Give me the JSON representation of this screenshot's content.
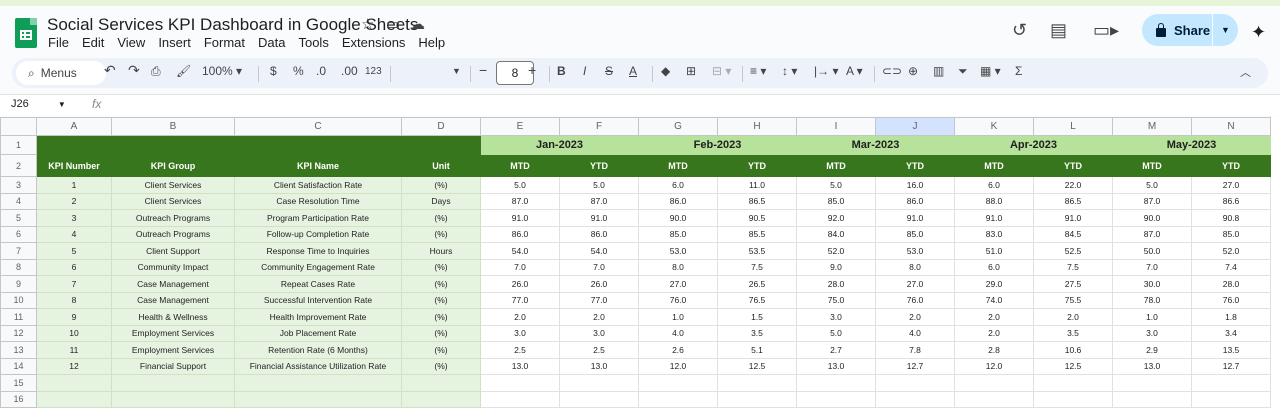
{
  "app": {
    "doc_title": "Social Services KPI Dashboard in Google Sheets",
    "menu": [
      "File",
      "Edit",
      "View",
      "Insert",
      "Format",
      "Data",
      "Tools",
      "Extensions",
      "Help"
    ],
    "share_label": "Share",
    "accent": "#c2e7ff",
    "header_dark": "#38761d",
    "header_light": "#b6e29b",
    "kpi_fill": "#e7f3e1"
  },
  "toolbar": {
    "menus_label": "Menus",
    "zoom": "100%",
    "currency": "$",
    "percent": "%",
    "dec_decrease": ".0",
    "dec_increase": ".00",
    "number_format": "123",
    "font_size": "8"
  },
  "formula_bar": {
    "cell_ref": "J26",
    "fx": "fx"
  },
  "columns": [
    "A",
    "B",
    "C",
    "D",
    "E",
    "F",
    "G",
    "H",
    "I",
    "J",
    "K",
    "L",
    "M",
    "N"
  ],
  "selected_column": "J",
  "row_numbers": [
    "1",
    "2",
    "3",
    "4",
    "5",
    "6",
    "7",
    "8",
    "9",
    "10",
    "11",
    "12",
    "13",
    "14",
    "15",
    "16"
  ],
  "months": [
    "Jan-2023",
    "Feb-2023",
    "Mar-2023",
    "Apr-2023",
    "May-2023"
  ],
  "headers": {
    "kpi_number": "KPI Number",
    "kpi_group": "KPI Group",
    "kpi_name": "KPI Name",
    "unit": "Unit",
    "mtd": "MTD",
    "ytd": "YTD"
  },
  "rows": [
    {
      "num": "1",
      "group": "Client Services",
      "name": "Client Satisfaction Rate",
      "unit": "(%)",
      "vals": [
        "5.0",
        "5.0",
        "6.0",
        "11.0",
        "5.0",
        "16.0",
        "6.0",
        "22.0",
        "5.0",
        "27.0"
      ]
    },
    {
      "num": "2",
      "group": "Client Services",
      "name": "Case Resolution Time",
      "unit": "Days",
      "vals": [
        "87.0",
        "87.0",
        "86.0",
        "86.5",
        "85.0",
        "86.0",
        "88.0",
        "86.5",
        "87.0",
        "86.6"
      ]
    },
    {
      "num": "3",
      "group": "Outreach Programs",
      "name": "Program Participation Rate",
      "unit": "(%)",
      "vals": [
        "91.0",
        "91.0",
        "90.0",
        "90.5",
        "92.0",
        "91.0",
        "91.0",
        "91.0",
        "90.0",
        "90.8"
      ]
    },
    {
      "num": "4",
      "group": "Outreach Programs",
      "name": "Follow-up Completion Rate",
      "unit": "(%)",
      "vals": [
        "86.0",
        "86.0",
        "85.0",
        "85.5",
        "84.0",
        "85.0",
        "83.0",
        "84.5",
        "87.0",
        "85.0"
      ]
    },
    {
      "num": "5",
      "group": "Client Support",
      "name": "Response Time to Inquiries",
      "unit": "Hours",
      "vals": [
        "54.0",
        "54.0",
        "53.0",
        "53.5",
        "52.0",
        "53.0",
        "51.0",
        "52.5",
        "50.0",
        "52.0"
      ]
    },
    {
      "num": "6",
      "group": "Community Impact",
      "name": "Community Engagement Rate",
      "unit": "(%)",
      "vals": [
        "7.0",
        "7.0",
        "8.0",
        "7.5",
        "9.0",
        "8.0",
        "6.0",
        "7.5",
        "7.0",
        "7.4"
      ]
    },
    {
      "num": "7",
      "group": "Case Management",
      "name": "Repeat Cases Rate",
      "unit": "(%)",
      "vals": [
        "26.0",
        "26.0",
        "27.0",
        "26.5",
        "28.0",
        "27.0",
        "29.0",
        "27.5",
        "30.0",
        "28.0"
      ]
    },
    {
      "num": "8",
      "group": "Case Management",
      "name": "Successful Intervention Rate",
      "unit": "(%)",
      "vals": [
        "77.0",
        "77.0",
        "76.0",
        "76.5",
        "75.0",
        "76.0",
        "74.0",
        "75.5",
        "78.0",
        "76.0"
      ]
    },
    {
      "num": "9",
      "group": "Health & Wellness",
      "name": "Health Improvement Rate",
      "unit": "(%)",
      "vals": [
        "2.0",
        "2.0",
        "1.0",
        "1.5",
        "3.0",
        "2.0",
        "2.0",
        "2.0",
        "1.0",
        "1.8"
      ]
    },
    {
      "num": "10",
      "group": "Employment Services",
      "name": "Job Placement Rate",
      "unit": "(%)",
      "vals": [
        "3.0",
        "3.0",
        "4.0",
        "3.5",
        "5.0",
        "4.0",
        "2.0",
        "3.5",
        "3.0",
        "3.4"
      ]
    },
    {
      "num": "11",
      "group": "Employment Services",
      "name": "Retention Rate (6 Months)",
      "unit": "(%)",
      "vals": [
        "2.5",
        "2.5",
        "2.6",
        "5.1",
        "2.7",
        "7.8",
        "2.8",
        "10.6",
        "2.9",
        "13.5"
      ]
    },
    {
      "num": "12",
      "group": "Financial Support",
      "name": "Financial Assistance Utilization Rate",
      "unit": "(%)",
      "vals": [
        "13.0",
        "13.0",
        "12.0",
        "12.5",
        "13.0",
        "12.7",
        "12.0",
        "12.5",
        "13.0",
        "12.7"
      ]
    }
  ]
}
